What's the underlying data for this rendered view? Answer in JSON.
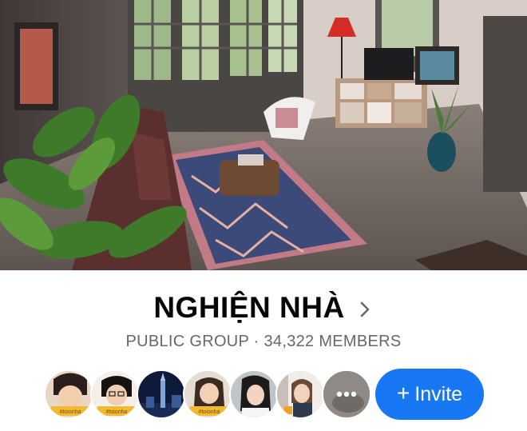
{
  "group": {
    "name": "NGHIỆN NHÀ",
    "meta": "PUBLIC GROUP · 34,322 MEMBERS"
  },
  "members": {
    "avatars": [
      {
        "badge": "#toionha"
      },
      {
        "badge": "#toionha"
      },
      {
        "badge": ""
      },
      {
        "badge": "#toionha"
      },
      {
        "badge": ""
      },
      {
        "badge": ""
      },
      {
        "badge": ""
      }
    ],
    "more_icon": "more-dots-icon"
  },
  "invite": {
    "label": "Invite",
    "icon": "+",
    "color": "#1877f2"
  },
  "colors": {
    "title": "#050505",
    "meta": "#65676b"
  }
}
